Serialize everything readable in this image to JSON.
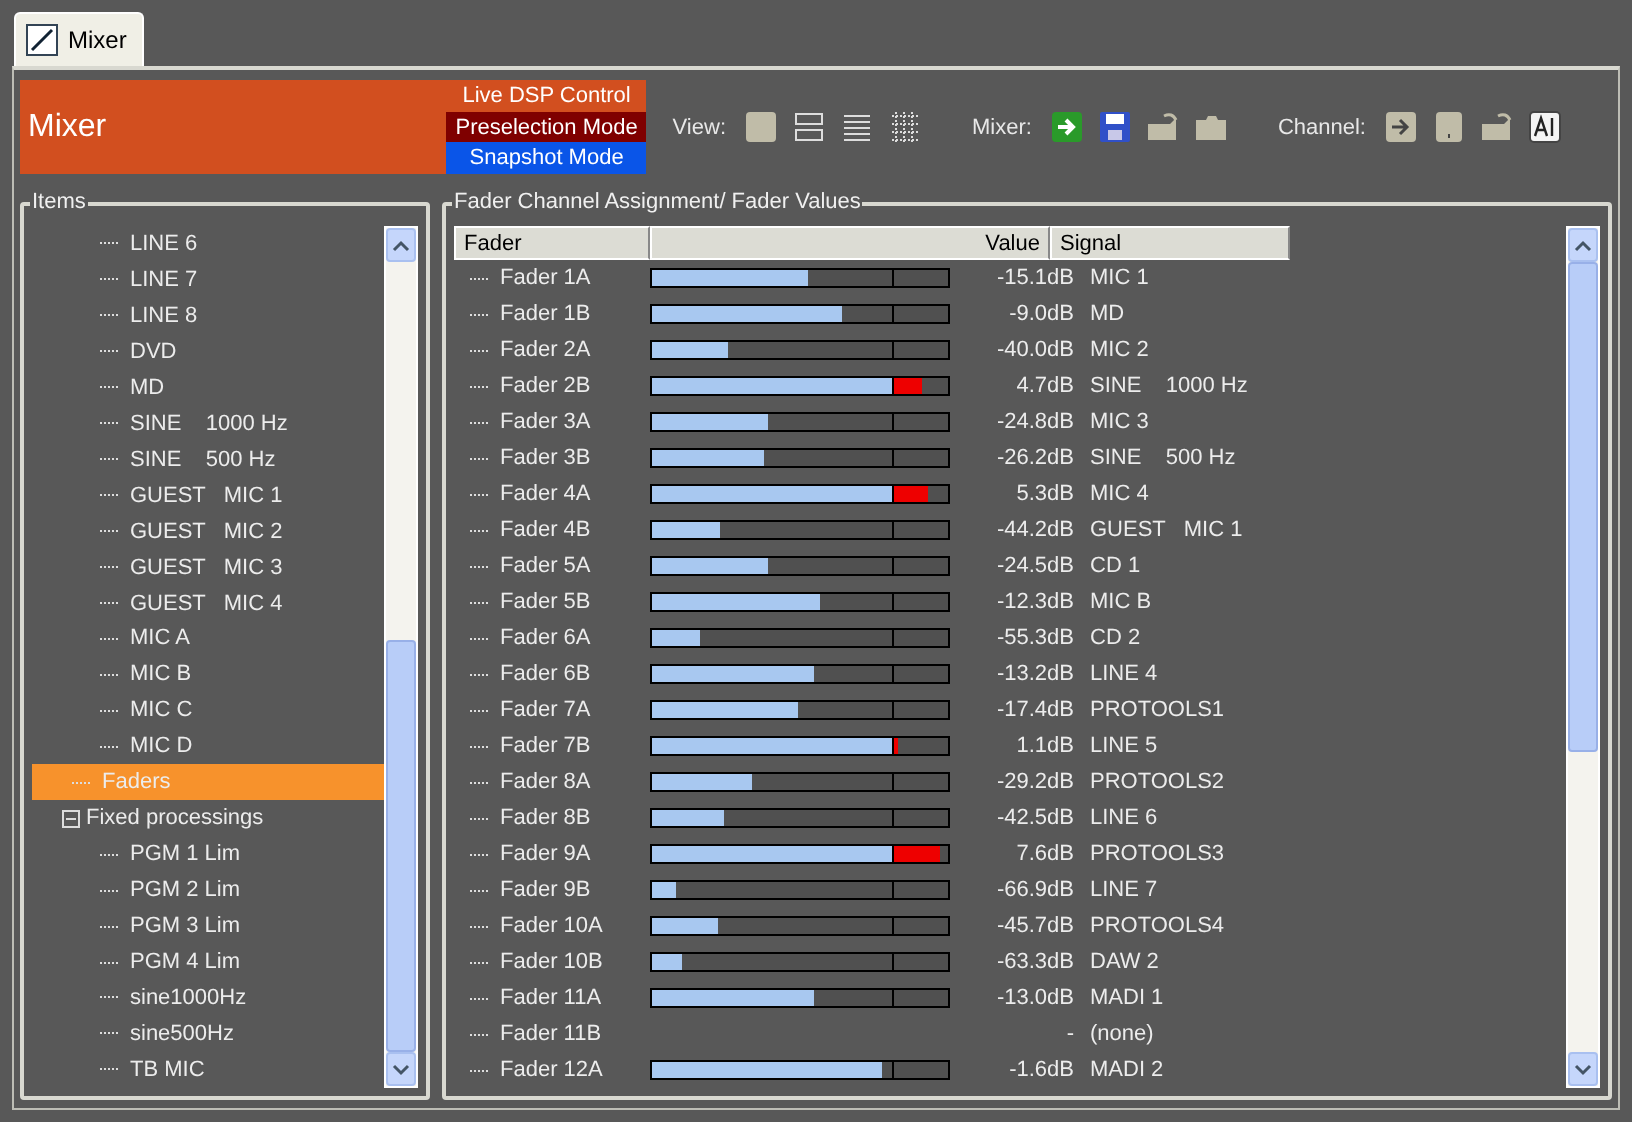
{
  "tabs": [
    {
      "label": "Mixer",
      "selected": true
    }
  ],
  "header": {
    "title": "Mixer",
    "modes": [
      {
        "label": "Live DSP Control",
        "color": "#d24f1f"
      },
      {
        "label": "Preselection Mode",
        "color": "#7f0000"
      },
      {
        "label": "Snapshot Mode",
        "color": "#0a55e8"
      }
    ]
  },
  "toolbar": [
    {
      "label": "View:",
      "kind": "view"
    },
    {
      "label": "Mixer:",
      "kind": "mixer"
    },
    {
      "label": "Channel:",
      "kind": "channel"
    }
  ],
  "items_panel": {
    "title": "Items",
    "tree": [
      {
        "children": [
          {
            "label": "LINE 6"
          },
          {
            "label": "LINE 7"
          },
          {
            "label": "LINE 8"
          },
          {
            "label": "DVD"
          },
          {
            "label": "MD"
          },
          {
            "label": "SINE    1000 Hz"
          },
          {
            "label": "SINE    500 Hz"
          },
          {
            "label": "GUEST   MIC 1"
          },
          {
            "label": "GUEST   MIC 2"
          },
          {
            "label": "GUEST   MIC 3"
          },
          {
            "label": "GUEST   MIC 4"
          },
          {
            "label": "MIC A"
          },
          {
            "label": "MIC B"
          },
          {
            "label": "MIC C"
          },
          {
            "label": "MIC D"
          }
        ]
      },
      {
        "label": "Faders",
        "selected": true
      },
      {
        "label": "Fixed processings",
        "expanded": true,
        "children": [
          {
            "label": "PGM 1 Lim"
          },
          {
            "label": "PGM 2 Lim"
          },
          {
            "label": "PGM 3 Lim"
          },
          {
            "label": "PGM 4 Lim"
          },
          {
            "label": "sine1000Hz"
          },
          {
            "label": "sine500Hz"
          },
          {
            "label": "TB MIC"
          }
        ]
      }
    ]
  },
  "faders_panel": {
    "title": "Fader Channel Assignment/ Fader Values",
    "columns": [
      "Fader",
      "Value",
      "Signal"
    ],
    "rows": [
      {
        "fader": "Fader 1A",
        "level": 0.53,
        "value": "-15.1dB",
        "signal": "MIC 1"
      },
      {
        "fader": "Fader 1B",
        "level": 0.64,
        "value": "-9.0dB",
        "signal": "MD"
      },
      {
        "fader": "Fader 2A",
        "level": 0.26,
        "value": "-40.0dB",
        "signal": "MIC 2"
      },
      {
        "fader": "Fader 2B",
        "level": 0.91,
        "value": "4.7dB",
        "signal": "SINE    1000 Hz"
      },
      {
        "fader": "Fader 3A",
        "level": 0.39,
        "value": "-24.8dB",
        "signal": "MIC 3"
      },
      {
        "fader": "Fader 3B",
        "level": 0.38,
        "value": "-26.2dB",
        "signal": "SINE    500 Hz"
      },
      {
        "fader": "Fader 4A",
        "level": 0.93,
        "value": "5.3dB",
        "signal": "MIC 4"
      },
      {
        "fader": "Fader 4B",
        "level": 0.23,
        "value": "-44.2dB",
        "signal": "GUEST   MIC 1"
      },
      {
        "fader": "Fader 5A",
        "level": 0.39,
        "value": "-24.5dB",
        "signal": "CD 1"
      },
      {
        "fader": "Fader 5B",
        "level": 0.57,
        "value": "-12.3dB",
        "signal": "MIC B"
      },
      {
        "fader": "Fader 6A",
        "level": 0.16,
        "value": "-55.3dB",
        "signal": "CD 2"
      },
      {
        "fader": "Fader 6B",
        "level": 0.55,
        "value": "-13.2dB",
        "signal": "LINE 4"
      },
      {
        "fader": "Fader 7A",
        "level": 0.49,
        "value": "-17.4dB",
        "signal": "PROTOOLS1"
      },
      {
        "fader": "Fader 7B",
        "level": 0.83,
        "value": "1.1dB",
        "signal": "LINE 5"
      },
      {
        "fader": "Fader 8A",
        "level": 0.34,
        "value": "-29.2dB",
        "signal": "PROTOOLS2"
      },
      {
        "fader": "Fader 8B",
        "level": 0.24,
        "value": "-42.5dB",
        "signal": "LINE 6"
      },
      {
        "fader": "Fader 9A",
        "level": 0.97,
        "value": "7.6dB",
        "signal": "PROTOOLS3"
      },
      {
        "fader": "Fader 9B",
        "level": 0.08,
        "value": "-66.9dB",
        "signal": "LINE 7"
      },
      {
        "fader": "Fader 10A",
        "level": 0.22,
        "value": "-45.7dB",
        "signal": "PROTOOLS4"
      },
      {
        "fader": "Fader 10B",
        "level": 0.1,
        "value": "-63.3dB",
        "signal": "DAW 2"
      },
      {
        "fader": "Fader 11A",
        "level": 0.55,
        "value": "-13.0dB",
        "signal": "MADI 1"
      },
      {
        "fader": "Fader 11B",
        "value": "-",
        "signal": "(none)"
      },
      {
        "fader": "Fader 12A",
        "level": 0.78,
        "value": "-1.6dB",
        "signal": "MADI 2"
      }
    ]
  }
}
